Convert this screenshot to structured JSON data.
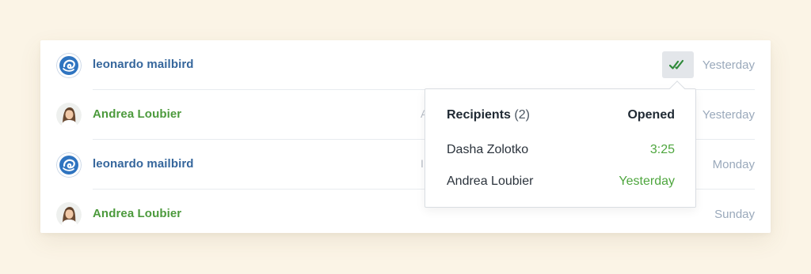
{
  "colors": {
    "background": "#fbf4e6",
    "sender_blue": "#35669c",
    "sender_green": "#4c9a3c",
    "date_gray": "#9aa9bb",
    "opened_green": "#4ea63e"
  },
  "emails": [
    {
      "sender": "leonardo mailbird",
      "avatar": "mailbird-logo-icon",
      "date": "Yesterday",
      "snippet_mark": ""
    },
    {
      "sender": "Andrea Loubier",
      "avatar": "user-photo-avatar",
      "date": "Yesterday",
      "snippet_mark": "A"
    },
    {
      "sender": "leonardo mailbird",
      "avatar": "mailbird-logo-icon",
      "date": "Monday",
      "snippet_mark": "I"
    },
    {
      "sender": "Andrea Loubier",
      "avatar": "user-photo-avatar",
      "date": "Sunday",
      "snippet_mark": ""
    }
  ],
  "read_receipt_icon": "double-check-icon",
  "popover": {
    "title": "Recipients",
    "count": "(2)",
    "opened_label": "Opened",
    "recipients": [
      {
        "name": "Dasha Zolotko",
        "time": "3:25"
      },
      {
        "name": "Andrea Loubier",
        "time": "Yesterday"
      }
    ]
  }
}
